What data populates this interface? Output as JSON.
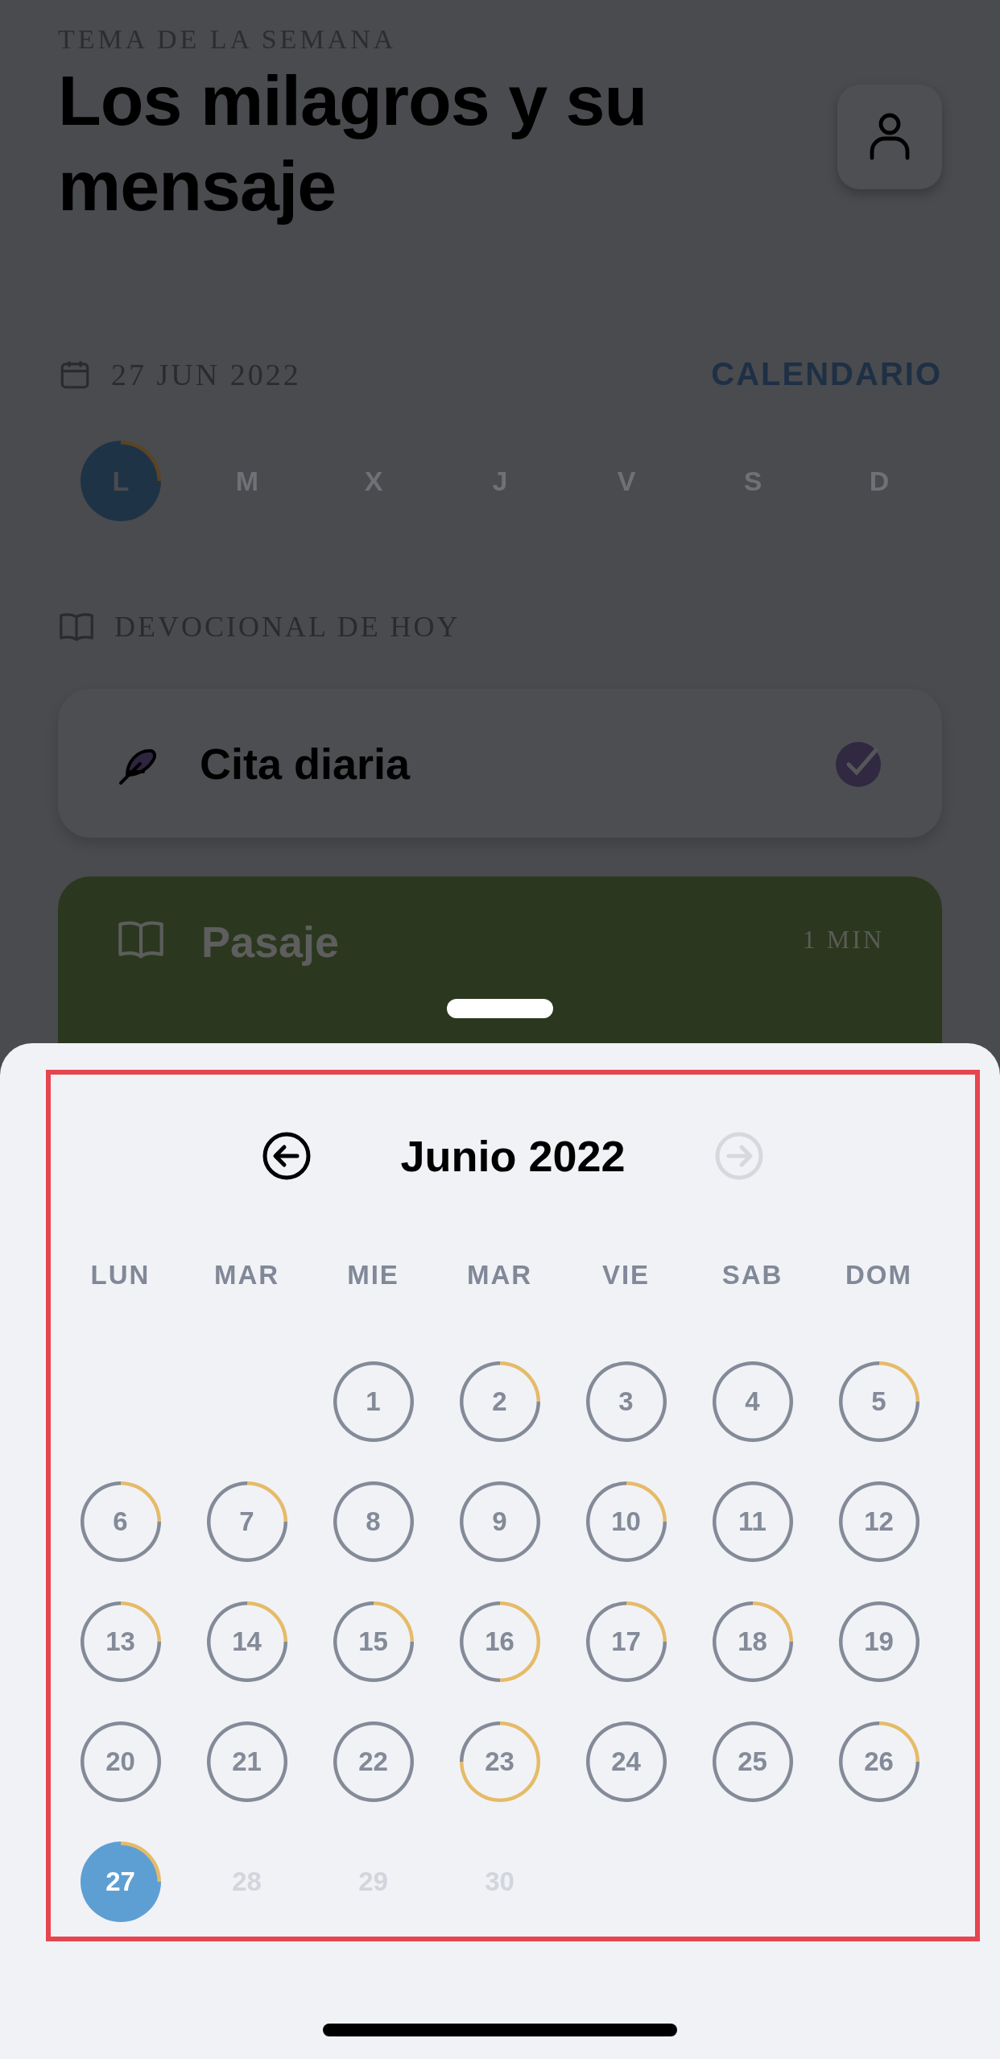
{
  "header": {
    "eyebrow": "TEMA DE LA SEMANA",
    "title": "Los milagros y su mensaje"
  },
  "date_row": {
    "date": "27 JUN 2022",
    "link": "CALENDARIO"
  },
  "week": [
    {
      "label": "L",
      "selected": true,
      "kind": "quarter"
    },
    {
      "label": "M",
      "selected": false,
      "kind": "plain"
    },
    {
      "label": "X",
      "selected": false,
      "kind": "plain"
    },
    {
      "label": "J",
      "selected": false,
      "kind": "plain"
    },
    {
      "label": "V",
      "selected": false,
      "kind": "plain"
    },
    {
      "label": "S",
      "selected": false,
      "kind": "plain"
    },
    {
      "label": "D",
      "selected": false,
      "kind": "plain"
    }
  ],
  "section_label": "DEVOCIONAL DE HOY",
  "items": [
    {
      "kind": "quote",
      "title": "Cita diaria",
      "checked": true
    },
    {
      "kind": "passage",
      "title": "Pasaje",
      "duration": "1 MIN"
    }
  ],
  "calendar": {
    "month": "Junio 2022",
    "prev_disabled": false,
    "next_disabled": true,
    "weekdays": [
      "LUN",
      "MAR",
      "MIE",
      "MAR",
      "VIE",
      "SAB",
      "DOM"
    ],
    "days": [
      {
        "kind": "blank"
      },
      {
        "kind": "blank"
      },
      {
        "kind": "plain",
        "label": "1",
        "selected": false,
        "disabled": false
      },
      {
        "kind": "quarter",
        "label": "2",
        "selected": false,
        "disabled": false
      },
      {
        "kind": "plain",
        "label": "3",
        "selected": false,
        "disabled": false
      },
      {
        "kind": "plain",
        "label": "4",
        "selected": false,
        "disabled": false
      },
      {
        "kind": "quarter",
        "label": "5",
        "selected": false,
        "disabled": false
      },
      {
        "kind": "quarter",
        "label": "6",
        "selected": false,
        "disabled": false
      },
      {
        "kind": "quarter",
        "label": "7",
        "selected": false,
        "disabled": false
      },
      {
        "kind": "plain",
        "label": "8",
        "selected": false,
        "disabled": false
      },
      {
        "kind": "plain",
        "label": "9",
        "selected": false,
        "disabled": false
      },
      {
        "kind": "quarter",
        "label": "10",
        "selected": false,
        "disabled": false
      },
      {
        "kind": "plain",
        "label": "11",
        "selected": false,
        "disabled": false
      },
      {
        "kind": "plain",
        "label": "12",
        "selected": false,
        "disabled": false
      },
      {
        "kind": "quarter",
        "label": "13",
        "selected": false,
        "disabled": false
      },
      {
        "kind": "quarter",
        "label": "14",
        "selected": false,
        "disabled": false
      },
      {
        "kind": "quarter",
        "label": "15",
        "selected": false,
        "disabled": false
      },
      {
        "kind": "half",
        "label": "16",
        "selected": false,
        "disabled": false
      },
      {
        "kind": "quarter",
        "label": "17",
        "selected": false,
        "disabled": false
      },
      {
        "kind": "quarter",
        "label": "18",
        "selected": false,
        "disabled": false
      },
      {
        "kind": "plain",
        "label": "19",
        "selected": false,
        "disabled": false
      },
      {
        "kind": "plain",
        "label": "20",
        "selected": false,
        "disabled": false
      },
      {
        "kind": "plain",
        "label": "21",
        "selected": false,
        "disabled": false
      },
      {
        "kind": "plain",
        "label": "22",
        "selected": false,
        "disabled": false
      },
      {
        "kind": "three_quarters",
        "label": "23",
        "selected": false,
        "disabled": false
      },
      {
        "kind": "plain",
        "label": "24",
        "selected": false,
        "disabled": false
      },
      {
        "kind": "plain",
        "label": "25",
        "selected": false,
        "disabled": false
      },
      {
        "kind": "quarter",
        "label": "26",
        "selected": false,
        "disabled": false
      },
      {
        "kind": "quarter",
        "label": "27",
        "selected": true,
        "disabled": false
      },
      {
        "kind": "plain",
        "label": "28",
        "selected": false,
        "disabled": true
      },
      {
        "kind": "plain",
        "label": "29",
        "selected": false,
        "disabled": true
      },
      {
        "kind": "plain",
        "label": "30",
        "selected": false,
        "disabled": true
      }
    ]
  }
}
